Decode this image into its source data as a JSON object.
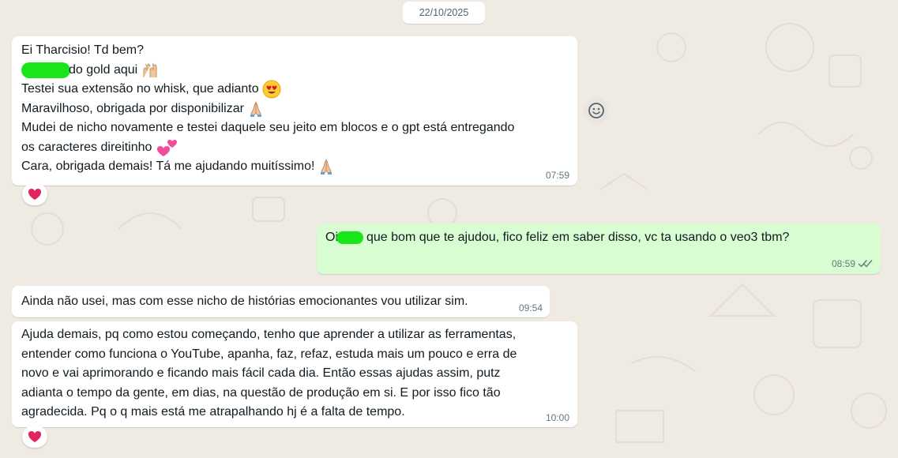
{
  "date_separator": "22/10/2025",
  "messages": [
    {
      "direction": "incoming",
      "lines": [
        "Ei Tharcisio! Td bem?",
        "do gold aqui",
        "Testei sua extensão no whisk, que adianto",
        "Maravilhoso, obrigada por disponibilizar",
        "Mudei de nicho novamente e testei daquele seu jeito em blocos e o gpt está entregando",
        "os caracteres direitinho",
        "Cara, obrigada demais! Tá me ajudando muitíssimo!"
      ],
      "time": "07:59",
      "reaction": "red-heart"
    },
    {
      "direction": "outgoing",
      "prefix": "Oi",
      "text": "que bom que te ajudou, fico feliz em saber disso, vc ta usando o veo3 tbm?",
      "time": "08:59",
      "status": "read-double-check"
    },
    {
      "direction": "incoming",
      "text": "Ainda não usei, mas com esse nicho de histórias emocionantes vou utilizar sim.",
      "time": "09:54"
    },
    {
      "direction": "incoming",
      "lines": [
        "Ajuda demais, pq como estou começando, tenho que aprender a utilizar as ferramentas,",
        "entender como funciona o YouTube, apanha, faz, refaz, estuda mais um pouco e erra de",
        "novo e vai aprimorando e ficando mais fácil cada dia. Então essas ajudas assim, putz",
        "adianta o tempo da gente, em dias, na questão de produção em si. E por isso fico tão",
        "agradecida. Pq o q mais está me atrapalhando hj é a falta de tempo."
      ],
      "time": "10:00",
      "reaction": "red-heart"
    }
  ],
  "icons": {
    "emoji_raised_hands": "raised-hands",
    "emoji_heart_eyes": "heart-eyes",
    "emoji_folded_hands": "folded-hands",
    "emoji_two_hearts": "two-hearts",
    "react_button": "smiley-icon",
    "reaction": "red-heart"
  },
  "colors": {
    "background": "#efeae2",
    "incoming_bubble": "#ffffff",
    "outgoing_bubble": "#d9fdd3",
    "timestamp": "#667781",
    "read_ticks": "#667781",
    "heart": "#e0245e",
    "redaction": "#19e619"
  }
}
